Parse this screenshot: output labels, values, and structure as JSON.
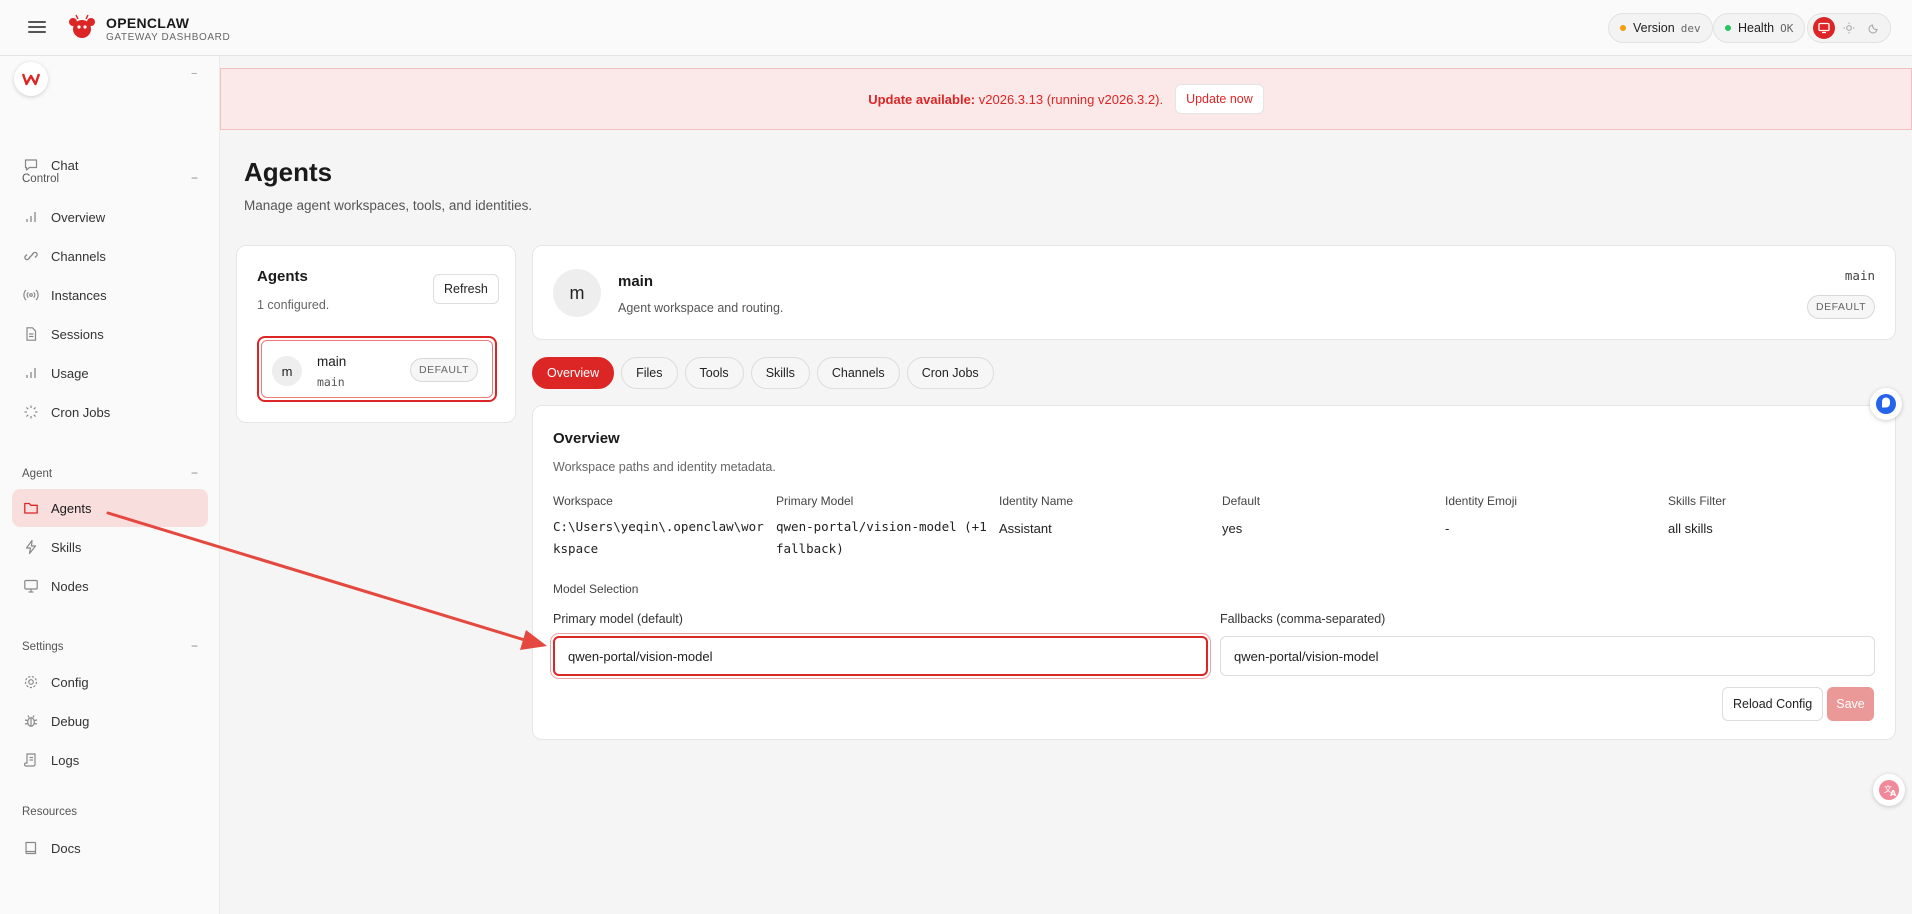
{
  "app": {
    "name": "OPENCLAW",
    "subtitle": "GATEWAY DASHBOARD",
    "brand_color": "#dc2626"
  },
  "status": {
    "version_label": "Version",
    "version_value": "dev",
    "version_dot": "#f59e0b",
    "health_label": "Health",
    "health_value": "OK",
    "health_dot": "#22c55e"
  },
  "theme": {
    "icons": [
      "monitor-icon",
      "sun-icon",
      "moon-icon"
    ],
    "active": "monitor-icon"
  },
  "sidebar": {
    "top_items": [
      {
        "label": "Chat",
        "icon": "chat-icon"
      }
    ],
    "sections": [
      {
        "label": "Control",
        "toggle": "−",
        "items": [
          {
            "label": "Overview",
            "icon": "bar-chart-icon"
          },
          {
            "label": "Channels",
            "icon": "link-icon"
          },
          {
            "label": "Instances",
            "icon": "broadcast-icon"
          },
          {
            "label": "Sessions",
            "icon": "document-icon"
          },
          {
            "label": "Usage",
            "icon": "bar-chart-icon"
          },
          {
            "label": "Cron Jobs",
            "icon": "loader-icon"
          }
        ]
      },
      {
        "label": "Agent",
        "toggle": "−",
        "items": [
          {
            "label": "Agents",
            "icon": "folder-icon",
            "active": true
          },
          {
            "label": "Skills",
            "icon": "bolt-icon"
          },
          {
            "label": "Nodes",
            "icon": "monitor-icon"
          }
        ]
      },
      {
        "label": "Settings",
        "toggle": "−",
        "items": [
          {
            "label": "Config",
            "icon": "gear-icon"
          },
          {
            "label": "Debug",
            "icon": "bug-icon"
          },
          {
            "label": "Logs",
            "icon": "scroll-icon"
          }
        ]
      },
      {
        "label": "Resources",
        "items": [
          {
            "label": "Docs",
            "icon": "book-icon"
          }
        ]
      }
    ]
  },
  "banner": {
    "prefix": "Update available:",
    "text": " v2026.3.13 (running v2026.3.2).",
    "button": "Update now"
  },
  "page": {
    "title": "Agents",
    "subtitle": "Manage agent workspaces, tools, and identities."
  },
  "agents_panel": {
    "title": "Agents",
    "count": "1 configured.",
    "refresh": "Refresh",
    "items": [
      {
        "avatar": "m",
        "name": "main",
        "id": "main",
        "badge": "DEFAULT"
      }
    ]
  },
  "agent_detail": {
    "avatar": "m",
    "name": "main",
    "description": "Agent workspace and routing.",
    "id": "main",
    "badge": "DEFAULT"
  },
  "tabs": [
    "Overview",
    "Files",
    "Tools",
    "Skills",
    "Channels",
    "Cron Jobs"
  ],
  "overview": {
    "title": "Overview",
    "subtitle": "Workspace paths and identity metadata.",
    "columns": [
      {
        "label": "Workspace",
        "value": "C:\\Users\\yeqin\\.openclaw\\workspace"
      },
      {
        "label": "Primary Model",
        "value": "qwen-portal/vision-model (+1 fallback)"
      },
      {
        "label": "Identity Name",
        "value": "Assistant"
      },
      {
        "label": "Default",
        "value": "yes"
      },
      {
        "label": "Identity Emoji",
        "value": "-"
      },
      {
        "label": "Skills Filter",
        "value": "all skills"
      }
    ],
    "model_selection_label": "Model Selection",
    "primary_label": "Primary model (default)",
    "primary_value": "qwen-portal/vision-model",
    "fallback_label": "Fallbacks (comma-separated)",
    "fallback_value": "qwen-portal/vision-model",
    "reload": "Reload Config",
    "save": "Save"
  }
}
